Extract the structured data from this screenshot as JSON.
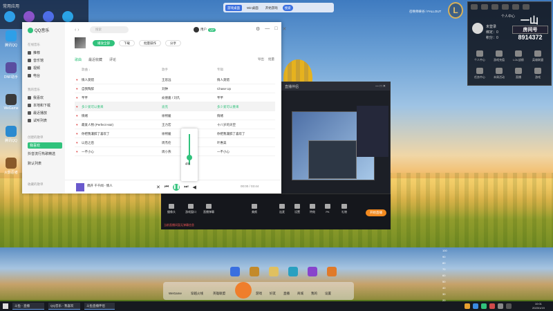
{
  "desktop": {
    "top_left_title": "常用应用",
    "icons": [
      {
        "label": "腾讯QQ",
        "color": "#2e9fe8"
      },
      {
        "label": "DNF助手",
        "color": "#5a4ea0"
      },
      {
        "label": "WeGame",
        "color": "#3a3a3a"
      },
      {
        "label": "腾讯QQ",
        "color": "#2a8ad0"
      },
      {
        "label": "火影忍者",
        "color": "#8a5a2a"
      }
    ],
    "top_mid": {
      "btn1": "游戏桌面",
      "btn2": "Win桌面",
      "btn3": "开始游戏",
      "btn4": "搜索"
    },
    "lol_logo": "L",
    "lol_text": "召唤师峡谷 / FALLOUT"
  },
  "right_panel": {
    "header": "个人中心",
    "glyph": "一山",
    "room_label": "房间号",
    "room_number": "8914372",
    "user_lines": [
      "未登录",
      "绑定：0",
      "积分：0"
    ],
    "grid_items": [
      "个人中心",
      "游戏充值",
      "LOL战绩",
      "英雄联盟",
      "任务中心",
      "本周活动",
      "直播",
      "游戏"
    ]
  },
  "qq_music": {
    "app_name": "QQ音乐",
    "search_placeholder": "搜索",
    "user_name": "用户",
    "vip_badge": "VIP",
    "window_controls": [
      "⚙",
      "—",
      "□",
      "✕"
    ],
    "sidebar": {
      "online_header": "在线音乐",
      "online_items": [
        "推荐",
        "音乐馆",
        "视频",
        "电台"
      ],
      "my_header": "我的音乐",
      "my_items": [
        "我喜欢",
        "本地和下载",
        "最近播放",
        "试听列表"
      ],
      "created_header": "创建的歌单",
      "playlists": [
        "我喜欢",
        "抖音流行热歌精选",
        "默认列表"
      ],
      "bottom": "收藏的歌单"
    },
    "actions": {
      "play_all": "播放全部",
      "download": "下载",
      "batch": "批量操作",
      "share": "分享"
    },
    "tabs": [
      "歌曲",
      "最近收藏",
      "评论"
    ],
    "tabs_right": [
      "导出",
      "批量"
    ],
    "columns": {
      "title": "歌曲 ↓",
      "artist": "歌手",
      "album": "专辑"
    },
    "songs": [
      {
        "title": "情人莫错",
        "artist": "王思远",
        "album": "情人莫错"
      },
      {
        "title": "自我陶醉",
        "artist": "刘钟",
        "album": "Chase Up"
      },
      {
        "title": "芊芊",
        "artist": "俞德嘉 / 刘凡",
        "album": "芊芊"
      },
      {
        "title": "多少爱可以重来",
        "artist": "迪克",
        "album": "多少爱可以重来"
      },
      {
        "title": "情绪",
        "artist": "徐熙媛",
        "album": "情绪"
      },
      {
        "title": "最爱人物 (Perfect Hair)",
        "artist": "王力宏",
        "album": "十八岁的天空"
      },
      {
        "title": "你把我灌醉了喜欢了",
        "artist": "徐熙媛",
        "album": "你把我灌醉了喜欢了"
      },
      {
        "title": "以后之后",
        "artist": "周杰伦",
        "album": "叶惠美"
      },
      {
        "title": "一不小心",
        "artist": "周小燕",
        "album": "一不小心"
      }
    ],
    "highlight_row": 3,
    "player": {
      "title": "偶开 千千闻 - 情人",
      "time": "00:00 / 03:44"
    },
    "volume_percent": "4%"
  },
  "obs": {
    "title": "直播伴侣",
    "items": [
      "摄像头",
      "游戏窗口",
      "直播弹幕",
      "美颜",
      "连麦",
      "设置",
      "特效",
      "PK",
      "礼物",
      "音乐",
      "分享"
    ],
    "live_button": "开始直播",
    "warning": "当前直播间暂无弹幕信息"
  },
  "scale_ticks": [
    "100",
    "90",
    "80",
    "70",
    "60",
    "50",
    "40",
    "30",
    "20"
  ],
  "dock": {
    "games": [
      {
        "color": "#3a6fe0"
      },
      {
        "color": "#c38a2a"
      },
      {
        "color": "#e0c060"
      },
      {
        "color": "#2aa0c0"
      },
      {
        "color": "#8844cc"
      },
      {
        "color": "#e07a2a"
      }
    ],
    "labels": [
      "WeGame",
      "穿越火线",
      "英雄联盟"
    ],
    "bottom_labels": [
      "游戏",
      "好友",
      "直播",
      "商城",
      "我的",
      "设置"
    ]
  },
  "taskbar": {
    "tasks": [
      "斗鱼 - 直播",
      "QQ音乐 - 我喜欢",
      "斗鱼直播伴侣"
    ],
    "time": "10:01",
    "date": "2023/1/19"
  }
}
